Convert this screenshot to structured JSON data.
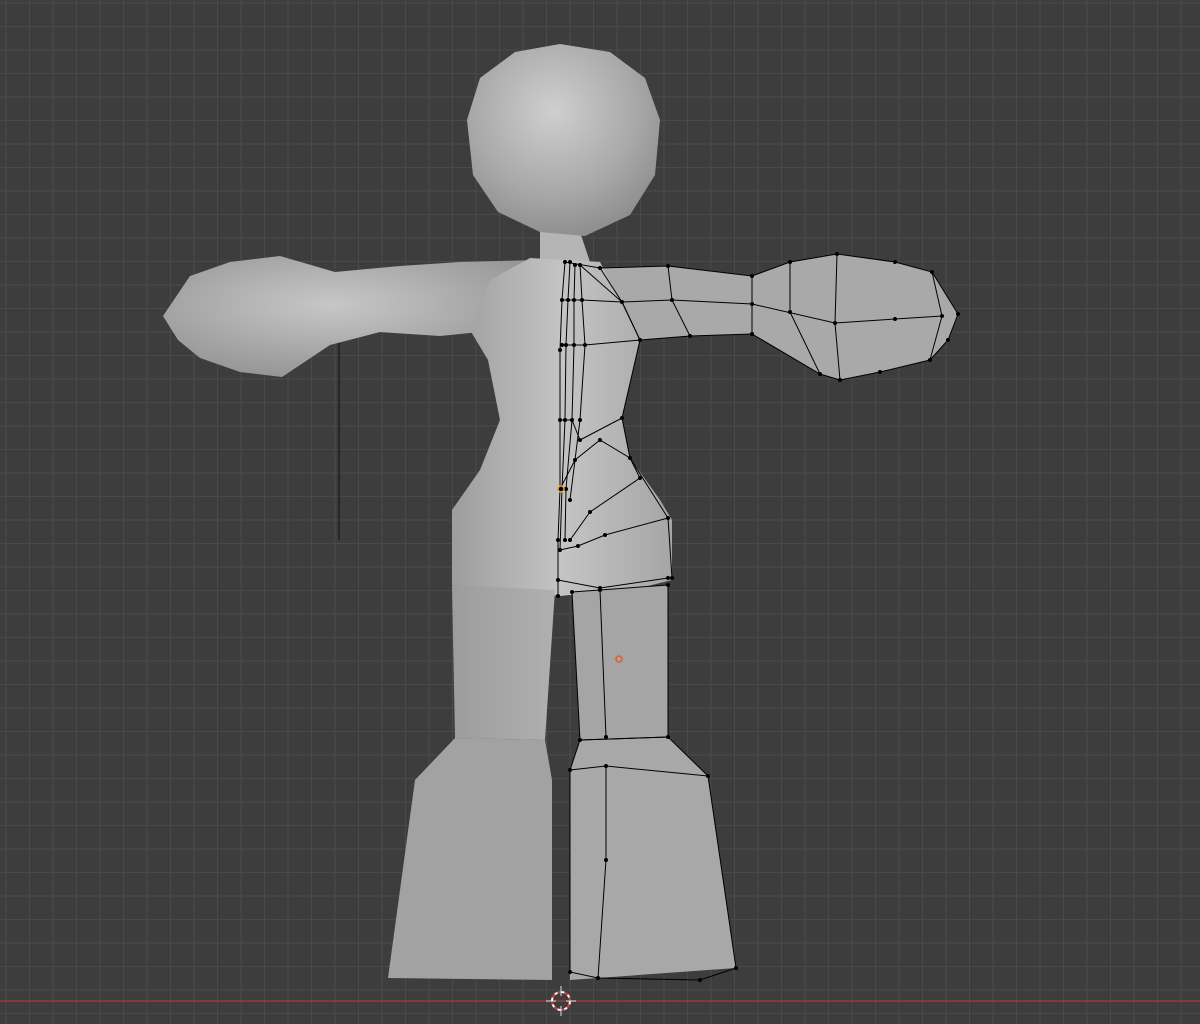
{
  "viewport": {
    "view": "front-orthographic",
    "mode": "edit-mode",
    "shading": "solid",
    "background_color": "#3d3d3d",
    "grid_line_color": "#4a4a4a",
    "grid_major_color": "#555555",
    "x_axis_color": "#9a3b3b",
    "mesh_fill_color": "#a3a3a3",
    "mesh_highlight_color": "#c9c9c9",
    "wire_color": "#000000",
    "vertex_color": "#000000",
    "origin_color": "#e8a33a",
    "cursor_icon": "3d-cursor-icon",
    "origin_icon": "object-origin-icon"
  },
  "object": {
    "type": "mesh",
    "symmetry": "x-mirror",
    "parts": [
      "head",
      "neck",
      "torso",
      "left-arm",
      "right-arm",
      "hips",
      "left-leg",
      "right-leg",
      "left-boot",
      "right-boot"
    ]
  }
}
